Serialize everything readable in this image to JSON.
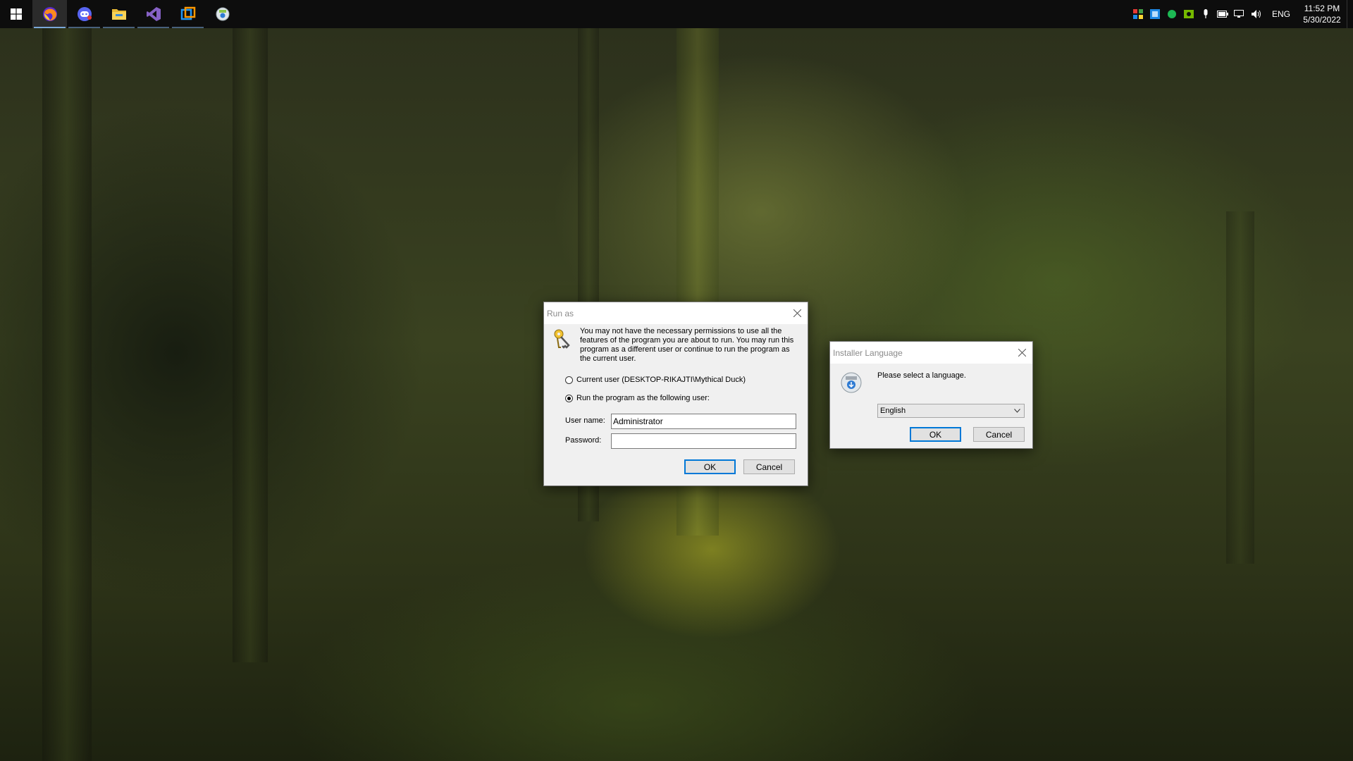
{
  "taskbar": {
    "apps": [
      {
        "name": "start-button",
        "icon": "windows-logo-icon"
      },
      {
        "name": "firefox",
        "icon": "firefox-icon"
      },
      {
        "name": "discord",
        "icon": "discord-icon"
      },
      {
        "name": "file-explorer",
        "icon": "folder-icon"
      },
      {
        "name": "visual-studio",
        "icon": "visual-studio-icon"
      },
      {
        "name": "virtual-machine-app",
        "icon": "vm-app-icon"
      },
      {
        "name": "installer-app",
        "icon": "installer-disc-icon"
      }
    ],
    "tray": {
      "language": "ENG",
      "time": "11:52 PM",
      "date": "5/30/2022"
    }
  },
  "run_as": {
    "title": "Run as",
    "message": "You may not have the necessary permissions to use all the features of the program you are about to run. You may run this program as a different user or continue to run the program as the current user.",
    "option_current": "Current user (DESKTOP-RIKAJTI\\Mythical Duck)",
    "option_other": "Run the program as the following user:",
    "username_label": "User name:",
    "username_value": "Administrator",
    "password_label": "Password:",
    "password_value": "",
    "ok": "OK",
    "cancel": "Cancel",
    "selected_option": "other"
  },
  "installer_language": {
    "title": "Installer Language",
    "prompt": "Please select a language.",
    "selected_language": "English",
    "ok": "OK",
    "cancel": "Cancel"
  },
  "colors": {
    "taskbar": "#0d0d0d",
    "dialog_bg": "#f0f0f0",
    "accent": "#0078d7"
  }
}
